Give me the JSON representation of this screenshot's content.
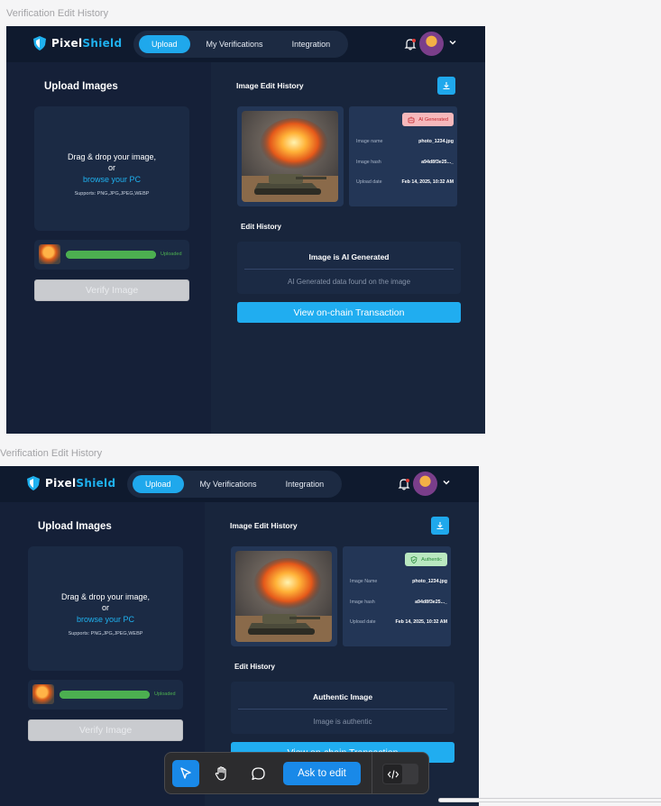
{
  "frames": [
    {
      "label": "Verification Edit History",
      "logo": {
        "part1": "Pixel",
        "part2": "Shield"
      },
      "nav": [
        {
          "label": "Upload",
          "active": true
        },
        {
          "label": "My Verifications",
          "active": false
        },
        {
          "label": "Integration",
          "active": false
        }
      ],
      "upload": {
        "heading": "Upload Images",
        "drag_text": "Drag & drop your image,",
        "or_text": "or",
        "browse_text": "browse your PC",
        "supports_text": "Supports: PNG,JPG,JPEG,WEBP",
        "status": "Uploaded",
        "progress": 1.0,
        "verify_label": "Verify Image"
      },
      "history": {
        "heading": "Image Edit History",
        "badge": "AI Generated",
        "badge_type": "ai",
        "meta": [
          {
            "key": "Image name",
            "value": "photo_1234.jpg"
          },
          {
            "key": "Image hash",
            "value": "a94d8f3e25..._"
          },
          {
            "key": "Upload date",
            "value": "Feb 14, 2025, 10:32 AM"
          }
        ],
        "edit_heading": "Edit History",
        "result_title": "Image is AI Generated",
        "result_desc": "AI Generated data found on the image",
        "chain_label": "View on-chain Transaction"
      }
    },
    {
      "label": "Verification Edit History",
      "logo": {
        "part1": "Pixel",
        "part2": "Shield"
      },
      "nav": [
        {
          "label": "Upload",
          "active": true
        },
        {
          "label": "My Verifications",
          "active": false
        },
        {
          "label": "Integration",
          "active": false
        }
      ],
      "upload": {
        "heading": "Upload Images",
        "drag_text": "Drag & drop your image,",
        "or_text": "or",
        "browse_text": "browse your PC",
        "supports_text": "Supports: PNG,JPG,JPEG,WEBP",
        "status": "Uploaded",
        "progress": 1.0,
        "verify_label": "Verify Image"
      },
      "history": {
        "heading": "Image Edit History",
        "badge": "Authentic",
        "badge_type": "ok",
        "meta": [
          {
            "key": "Image Name",
            "value": "photo_1234.jpg"
          },
          {
            "key": "Image hash",
            "value": "a94d8f3e25..._"
          },
          {
            "key": "Upload date",
            "value": "Feb 14, 2025, 10:32 AM"
          }
        ],
        "edit_heading": "Edit History",
        "result_title": "Authentic Image",
        "result_desc": "Image is authentic",
        "chain_label": "View on-chain Transaction"
      }
    }
  ],
  "toolbar": {
    "ask_label": "Ask to edit",
    "tools": [
      "cursor-icon",
      "hand-icon",
      "comment-icon",
      "code-icon"
    ]
  },
  "colors": {
    "accent": "#1fa8ec",
    "dark_bg": "#162238",
    "ai_badge": "#f6b8bb",
    "ok_badge": "#b9e8c0"
  }
}
